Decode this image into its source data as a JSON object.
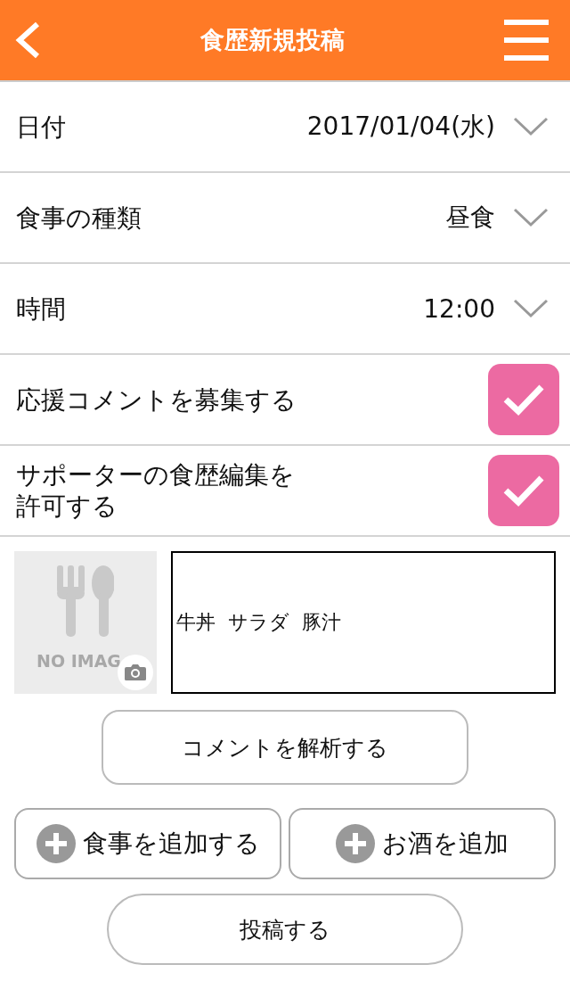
{
  "header": {
    "title": "食歴新規投稿"
  },
  "rows": [
    {
      "kind": "select",
      "label": "日付",
      "value": "2017/01/04(水)"
    },
    {
      "kind": "select",
      "label": "食事の種類",
      "value": "昼食"
    },
    {
      "kind": "select",
      "label": "時間",
      "value": "12:00"
    },
    {
      "kind": "checkbox",
      "label": "応援コメントを募集する",
      "checked": true
    },
    {
      "kind": "checkbox",
      "label": "サポーターの食歴編集を許可する",
      "checked": true
    }
  ],
  "photo": {
    "placeholder_text": "NO IMAG"
  },
  "comment": {
    "value": "牛丼  サラダ  豚汁"
  },
  "analyze_button": "コメントを解析する",
  "add_buttons": [
    {
      "label": "食事を追加する"
    },
    {
      "label": "お酒を追加"
    }
  ],
  "post_button": "投稿する"
}
